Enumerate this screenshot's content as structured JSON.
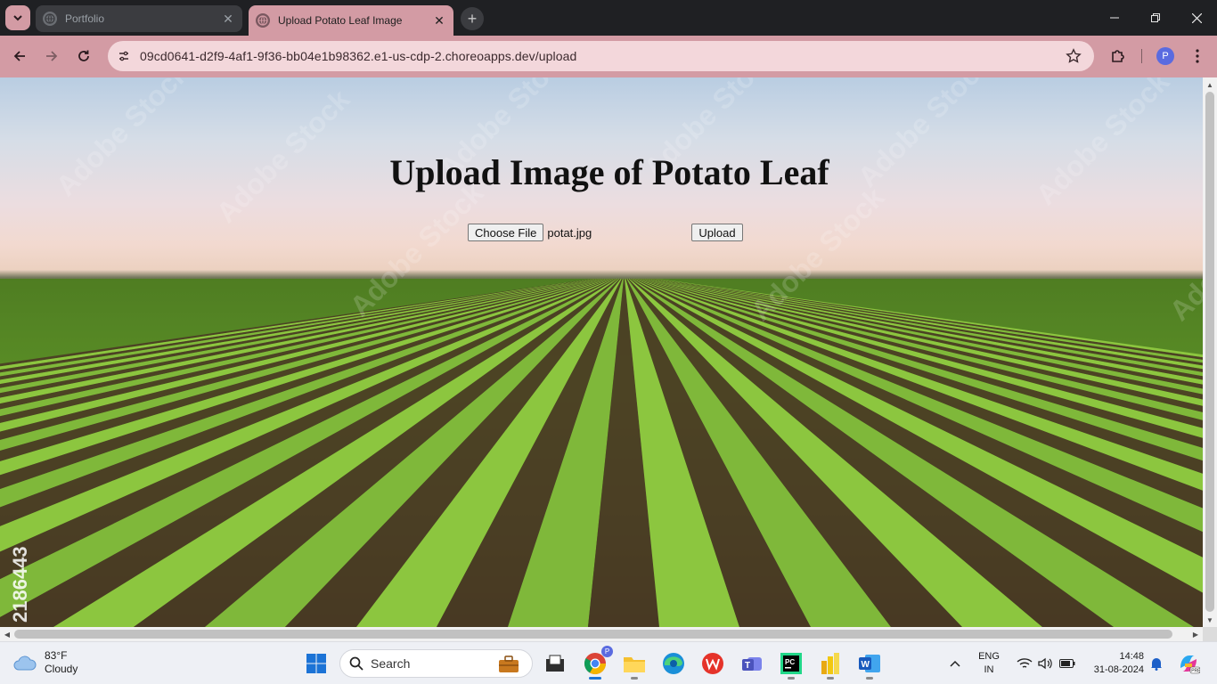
{
  "browser": {
    "tabs": [
      {
        "title": "Portfolio",
        "active": false
      },
      {
        "title": "Upload Potato Leaf Image",
        "active": true
      }
    ],
    "new_tab_label": "+",
    "url": "09cd0641-d2f9-4af1-9f36-bb04e1b98362.e1-us-cdp-2.choreoapps.dev/upload",
    "profile_initial": "P",
    "accent_color": "#d39ba4"
  },
  "page": {
    "heading": "Upload Image of Potato Leaf",
    "choose_file_label": "Choose File",
    "selected_file": "potat.jpg",
    "upload_label": "Upload",
    "watermark_text": "Adobe Stock",
    "stock_id": "2186443"
  },
  "taskbar": {
    "weather": {
      "temp": "83°F",
      "condition": "Cloudy"
    },
    "search_placeholder": "Search",
    "language": {
      "lang": "ENG",
      "region": "IN"
    },
    "clock": {
      "time": "14:48",
      "date": "31-08-2024"
    },
    "pinned_apps": [
      "file-explorer-icon",
      "chrome-icon",
      "folder-icon",
      "edge-icon",
      "wps-icon",
      "teams-icon",
      "pycharm-icon",
      "power-bi-icon",
      "word-icon"
    ]
  }
}
